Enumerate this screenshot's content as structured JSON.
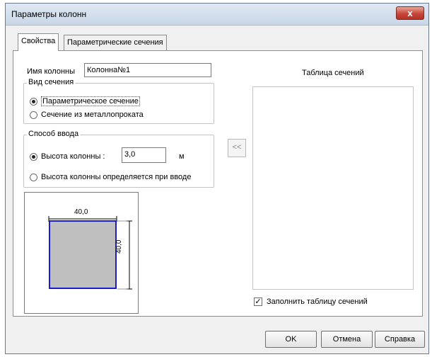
{
  "window": {
    "title": "Параметры колонн",
    "close_symbol": "x"
  },
  "tabs": [
    {
      "label": "Свойства",
      "active": true
    },
    {
      "label": "Параметрические сечения",
      "active": false
    }
  ],
  "column_name": {
    "label": "Имя колонны",
    "value": "Колонна№1"
  },
  "section_type": {
    "legend": "Вид сечения",
    "options": [
      {
        "label": "Параметрическое сечение",
        "selected": true
      },
      {
        "label": "Сечение из металлопроката",
        "selected": false
      }
    ]
  },
  "input_method": {
    "legend": "Способ ввода",
    "height_option": {
      "label": "Высота колонны :",
      "selected": true
    },
    "height_value": "3,0",
    "height_unit": "м",
    "defined_option": {
      "label": "Высота колонны определяется при вводе",
      "selected": false
    }
  },
  "preview": {
    "width_label": "40,0",
    "height_label": "40,0",
    "fill_color": "#bfbfbf",
    "border_color": "#1c1cc8"
  },
  "transfer_button": {
    "label": "<<"
  },
  "sections_table": {
    "title": "Таблица сечений"
  },
  "fill_table": {
    "label": "Заполнить таблицу сечений",
    "checked": true,
    "check_glyph": "✓"
  },
  "buttons": {
    "ok": "OK",
    "cancel": "Отмена",
    "help": "Справка"
  }
}
